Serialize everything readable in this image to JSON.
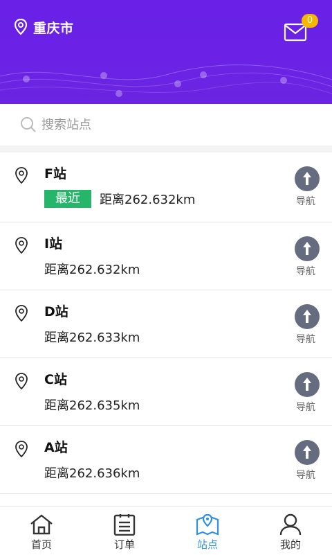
{
  "header": {
    "city": "重庆市",
    "message_count": "0",
    "colors": {
      "bg": "#6a20e6",
      "badge": "#f5b700"
    }
  },
  "search": {
    "placeholder": "搜索站点",
    "value": ""
  },
  "stations": [
    {
      "name": "F站",
      "tag": "最近",
      "distance": "距离262.632km",
      "nav_label": "导航"
    },
    {
      "name": "I站",
      "tag": "",
      "distance": "距离262.632km",
      "nav_label": "导航"
    },
    {
      "name": "D站",
      "tag": "",
      "distance": "距离262.633km",
      "nav_label": "导航"
    },
    {
      "name": "C站",
      "tag": "",
      "distance": "距离262.635km",
      "nav_label": "导航"
    },
    {
      "name": "A站",
      "tag": "",
      "distance": "距离262.636km",
      "nav_label": "导航"
    }
  ],
  "tabbar": {
    "items": [
      {
        "label": "首页",
        "icon": "home-icon",
        "active": false
      },
      {
        "label": "订单",
        "icon": "order-icon",
        "active": false
      },
      {
        "label": "站点",
        "icon": "station-map-icon",
        "active": true
      },
      {
        "label": "我的",
        "icon": "user-icon",
        "active": false
      }
    ],
    "active_color": "#2f8fe0"
  }
}
